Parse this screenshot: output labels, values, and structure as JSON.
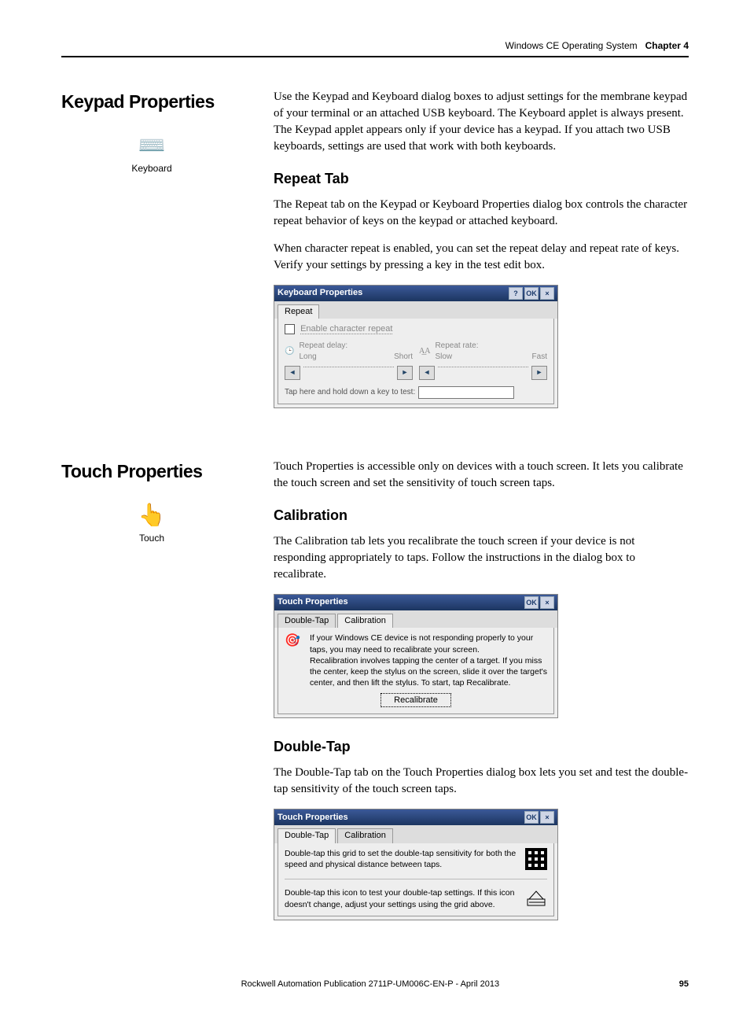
{
  "header": {
    "section": "Windows CE Operating System",
    "chapter": "Chapter 4"
  },
  "keypad": {
    "title": "Keypad Properties",
    "iconLabel": "Keyboard",
    "intro": "Use the Keypad and Keyboard dialog boxes to adjust settings for the membrane keypad of your terminal or an attached USB keyboard. The Keyboard applet is always present. The Keypad applet appears only if your device has a keypad. If you attach two USB keyboards, settings are used that work with both keyboards.",
    "repeat": {
      "title": "Repeat Tab",
      "p1": "The Repeat tab on the Keypad or Keyboard Properties dialog box controls the character repeat behavior of keys on the keypad or attached keyboard.",
      "p2": "When character repeat is enabled, you can set the repeat delay and repeat rate of keys. Verify your settings by pressing a key in the test edit box.",
      "dialog": {
        "title": "Keyboard Properties",
        "help": "?",
        "ok": "OK",
        "close": "×",
        "tab": "Repeat",
        "checkbox": "Enable character repeat",
        "delayLabel": "Repeat delay:",
        "delayLo": "Long",
        "delayHi": "Short",
        "rateLabel": "Repeat rate:",
        "rateLo": "Slow",
        "rateHi": "Fast",
        "testLabel": "Tap here and hold down a key to test:"
      }
    }
  },
  "touch": {
    "title": "Touch Properties",
    "iconLabel": "Touch",
    "intro": "Touch Properties is accessible only on devices with a touch screen. It lets you calibrate the touch screen and set the sensitivity of touch screen taps.",
    "calibration": {
      "title": "Calibration",
      "p1": "The Calibration tab lets you recalibrate the touch screen if your device is not responding appropriately to taps. Follow the instructions in the dialog box to recalibrate.",
      "dialog": {
        "title": "Touch Properties",
        "ok": "OK",
        "close": "×",
        "tab1": "Double-Tap",
        "tab2": "Calibration",
        "msg1": "If your Windows CE device is not responding properly to your taps, you may need to recalibrate your screen.",
        "msg2": "Recalibration involves tapping the center of a target. If you miss the center, keep the stylus on the screen, slide it over the target's center, and then lift the stylus. To start, tap Recalibrate.",
        "btn": "Recalibrate"
      }
    },
    "doubletap": {
      "title": "Double-Tap",
      "p1": "The Double-Tap tab on the Touch Properties dialog box lets you set and test the double-tap sensitivity of the touch screen taps.",
      "dialog": {
        "title": "Touch Properties",
        "ok": "OK",
        "close": "×",
        "tab1": "Double-Tap",
        "tab2": "Calibration",
        "msg1": "Double-tap this grid to set the double-tap sensitivity for both the speed and physical distance between taps.",
        "msg2": "Double-tap this icon to test your double-tap settings. If this icon doesn't change, adjust your settings using the grid above."
      }
    }
  },
  "footer": {
    "pub": "Rockwell Automation Publication 2711P-UM006C-EN-P - April 2013",
    "page": "95"
  }
}
